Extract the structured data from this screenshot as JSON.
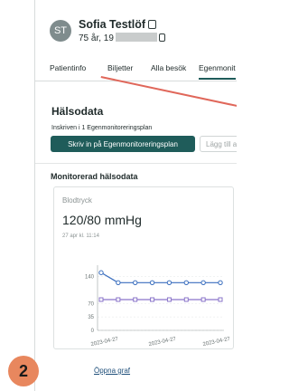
{
  "patient": {
    "initials": "ST",
    "name": "Sofia Testlöf",
    "age_prefix": "75 år, 19",
    "icons": {
      "name_icon": "copy-icon",
      "age_icon": "copy-icon"
    }
  },
  "tabs": [
    {
      "label": "Patientinfo"
    },
    {
      "label": "Biljetter"
    },
    {
      "label": "Alla besök"
    },
    {
      "label": "Egenmonit"
    }
  ],
  "health": {
    "title": "Hälsodata",
    "enrolled_text": "Inskriven i 1 Egenmonitoreringsplan",
    "enroll_button": "Skriv in på Egenmonitoreringsplan",
    "add_button": "Lägg till ak"
  },
  "monitored": {
    "title": "Monitorerad hälsodata",
    "card": {
      "metric": "Blodtryck",
      "value": "120/80 mmHg",
      "timestamp": "27 apr kl. 11:14",
      "link": "Öppna graf"
    }
  },
  "step_marker": "2",
  "colors": {
    "primary": "#1f5c5a",
    "systolic": "#3b6fbf",
    "diastolic": "#8a74c9",
    "annotation": "#e0675a",
    "badge": "#e8875e"
  },
  "chart_data": {
    "type": "line",
    "y_ticks": [
      "140",
      "70",
      "35",
      "0"
    ],
    "x_ticks": [
      "2023-04-27",
      "2023-04-27",
      "2023-04-27"
    ],
    "ylim": [
      0,
      160
    ],
    "series": [
      {
        "values": [
          150,
          124,
          124,
          124,
          124,
          124,
          124,
          124
        ]
      },
      {
        "values": [
          80,
          80,
          80,
          80,
          80,
          80,
          80,
          80
        ]
      }
    ]
  }
}
